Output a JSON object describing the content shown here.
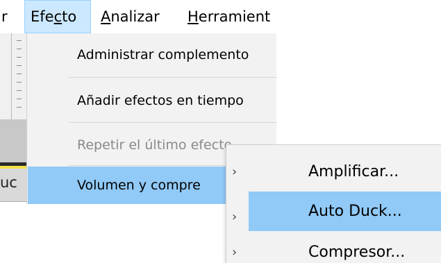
{
  "menubar": {
    "items": [
      {
        "label": "r",
        "id": "partial"
      },
      {
        "label_pre": "Efe",
        "label_ul": "c",
        "label_post": "to",
        "id": "efecto"
      },
      {
        "label_ul": "A",
        "label_post": "nalizar",
        "id": "analizar"
      },
      {
        "label_ul": "H",
        "label_post": "erramient",
        "id": "herramientas"
      }
    ]
  },
  "app": {
    "track_label": "uc"
  },
  "effect_menu": {
    "items": [
      {
        "label": "Administrar complemento",
        "enabled": true
      },
      {
        "label": "Añadir efectos en tiempo",
        "enabled": true
      },
      {
        "label": "Repetir el último efecto",
        "enabled": false
      },
      {
        "label": "Volumen y compre",
        "enabled": true,
        "highlighted": true
      }
    ]
  },
  "submenu": {
    "items": [
      {
        "label": "Amplificar...",
        "arrow": "›"
      },
      {
        "label": "Auto Duck...",
        "arrow": "›",
        "highlighted": true
      },
      {
        "label": "Compresor...",
        "arrow": "›"
      }
    ]
  },
  "colors": {
    "menu_bg": "#f2f2f2",
    "highlight": "#91c9f7",
    "menubar_active": "#cce8ff"
  }
}
